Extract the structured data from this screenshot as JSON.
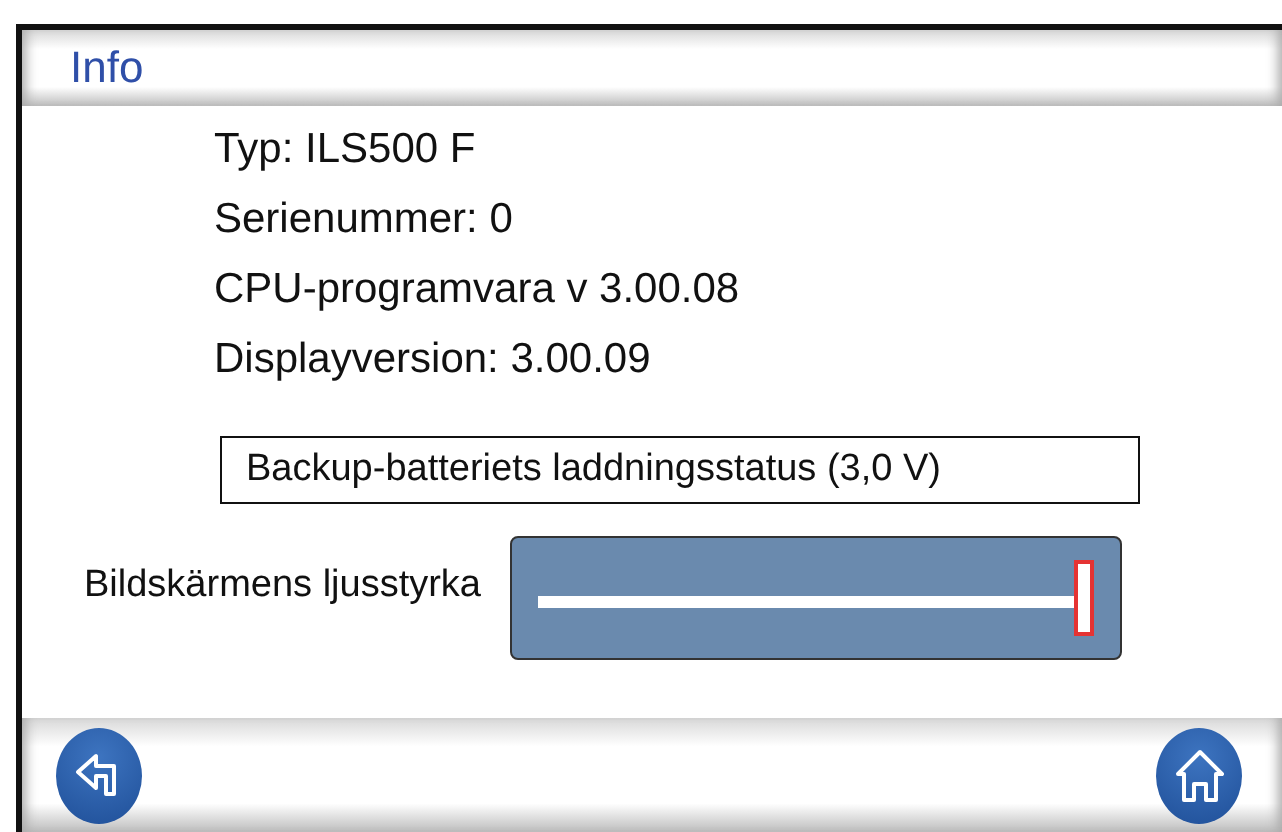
{
  "header": {
    "title": "Info"
  },
  "info_lines": [
    "Typ: ILS500 F",
    "Serienummer: 0",
    "CPU-programvara v 3.00.08",
    "Displayversion: 3.00.09"
  ],
  "battery_status": "Backup-batteriets laddningsstatus (3,0 V)",
  "brightness": {
    "label": "Bildskärmens ljusstyrka",
    "level": 1.0
  },
  "footer": {
    "buttons": [
      {
        "kind": "back"
      },
      {
        "kind": "home"
      }
    ]
  }
}
